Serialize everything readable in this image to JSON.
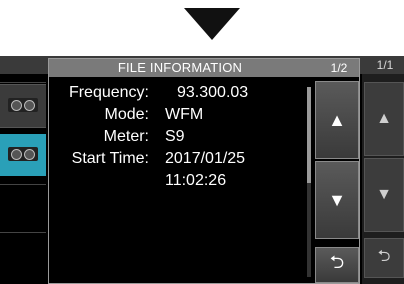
{
  "dialog": {
    "title": "FILE INFORMATION",
    "page": "1/2",
    "fields": [
      {
        "label": "Frequency:",
        "value": "93.300.03"
      },
      {
        "label": "Mode:",
        "value": "WFM"
      },
      {
        "label": "Meter:",
        "value": "S9"
      },
      {
        "label": "Start Time:",
        "value": "2017/01/25"
      },
      {
        "label": "",
        "value": "11:02:26"
      }
    ]
  },
  "background_list": {
    "page": "1/1"
  },
  "icons": {
    "up": "▲",
    "down": "▼",
    "return": "⮌"
  }
}
